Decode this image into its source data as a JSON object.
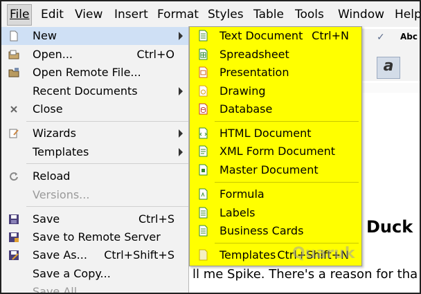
{
  "menubar": {
    "items": [
      "File",
      "Edit",
      "View",
      "Insert",
      "Format",
      "Styles",
      "Table",
      "Tools",
      "Window",
      "Help"
    ]
  },
  "file_menu": {
    "items": [
      {
        "label": "New",
        "icon": "new-document-icon",
        "submenu": true
      },
      {
        "label": "Open...",
        "shortcut": "Ctrl+O",
        "icon": "open-folder-icon"
      },
      {
        "label": "Open Remote File...",
        "icon": "open-remote-icon"
      },
      {
        "label": "Recent Documents",
        "submenu": true
      },
      {
        "label": "Close",
        "icon": "close-icon"
      },
      {
        "label": "Wizards",
        "icon": "wizard-icon",
        "submenu": true
      },
      {
        "label": "Templates",
        "submenu": true
      },
      {
        "label": "Reload",
        "icon": "reload-icon"
      },
      {
        "label": "Versions...",
        "disabled": true
      },
      {
        "label": "Save",
        "shortcut": "Ctrl+S",
        "icon": "save-icon"
      },
      {
        "label": "Save to Remote Server",
        "icon": "save-remote-icon"
      },
      {
        "label": "Save As...",
        "shortcut": "Ctrl+Shift+S",
        "icon": "save-as-icon"
      },
      {
        "label": "Save a Copy..."
      },
      {
        "label": "Save All",
        "disabled": true
      }
    ]
  },
  "new_submenu": {
    "items": [
      {
        "label": "Text Document",
        "shortcut": "Ctrl+N",
        "icon": "writer-icon"
      },
      {
        "label": "Spreadsheet",
        "icon": "calc-icon"
      },
      {
        "label": "Presentation",
        "icon": "impress-icon"
      },
      {
        "label": "Drawing",
        "icon": "draw-icon"
      },
      {
        "label": "Database",
        "icon": "base-icon"
      },
      {
        "label": "HTML Document",
        "icon": "html-doc-icon"
      },
      {
        "label": "XML Form Document",
        "icon": "xml-form-icon"
      },
      {
        "label": "Master Document",
        "icon": "master-doc-icon"
      },
      {
        "label": "Formula",
        "icon": "math-icon"
      },
      {
        "label": "Labels",
        "icon": "labels-icon"
      },
      {
        "label": "Business Cards",
        "icon": "business-cards-icon"
      },
      {
        "label": "Templates",
        "shortcut": "Ctrl+Shift+N",
        "icon": "templates-icon"
      }
    ]
  },
  "document": {
    "heading": "Duck",
    "body": "ll me Spike. There's a reason for tha",
    "toolbar_text": "Abc"
  },
  "watermark": "Quaruk",
  "colors": {
    "submenu_highlight": "#ffff00",
    "menu_hover": "#cfe0f5",
    "menu_bg": "#f2f2f2"
  }
}
